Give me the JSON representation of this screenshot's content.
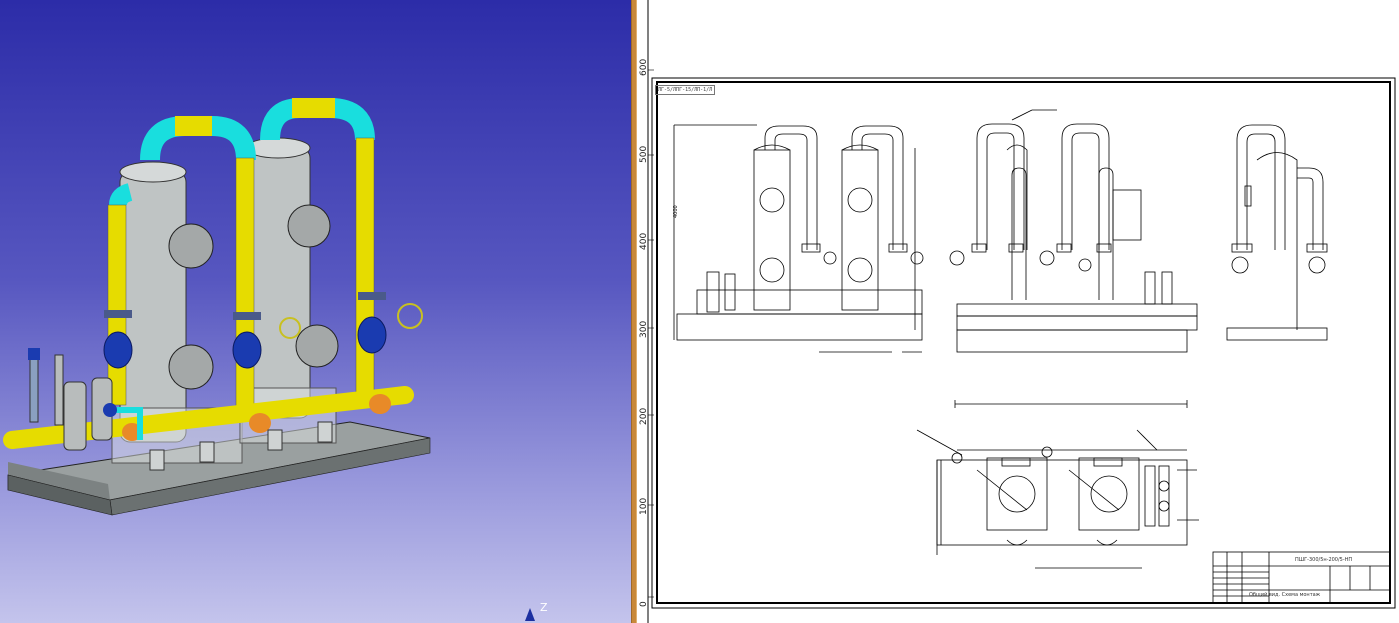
{
  "viewport3d": {
    "axis_label": "Z",
    "colors": {
      "bg_top": "#2c2ca8",
      "bg_bottom": "#c4c4ec",
      "pipe": "#e6dc00",
      "bend": "#19dede",
      "vessel": "#b8bcbc",
      "valve": "#1a3bb0",
      "fitting": "#e88a28",
      "base": "#8e9494"
    }
  },
  "drawing": {
    "ruler": [
      "600",
      "500",
      "400",
      "300",
      "200",
      "100",
      "0"
    ],
    "sheet_code": "ЛГ-5/ЛПГ-15/ЛП-1/Л",
    "title_block": {
      "designation": "ПШГ-300/5н-200/5-НП",
      "name": "Общий вид. Схема монтаж"
    }
  }
}
